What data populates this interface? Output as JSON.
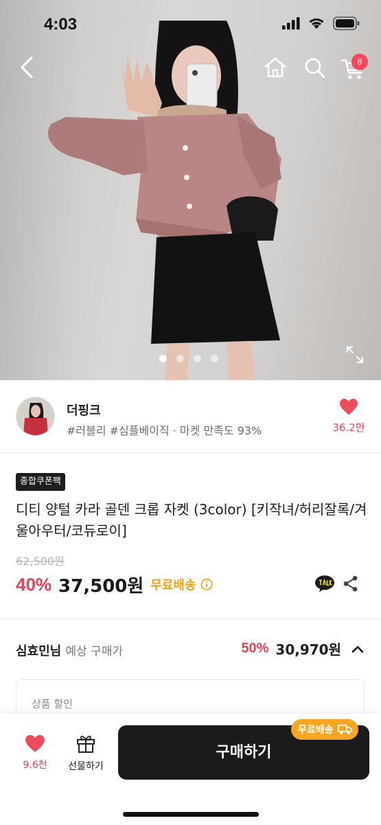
{
  "status_bar": {
    "time": "4:03"
  },
  "nav": {
    "cart_count": "8"
  },
  "gallery": {
    "page_count": 4,
    "active_index": 0
  },
  "seller": {
    "name": "더핑크",
    "meta": "#러블리 #심플베이직 · 마켓 만족도 93%",
    "like_count": "36.2만"
  },
  "product": {
    "badge": "종합쿠폰팩",
    "title": "디티 양털 카라 골덴 크롭 자켓 (3color) [키작녀/허리잘록/겨울아우터/코듀로이]",
    "original_price": "62,500원",
    "discount_rate": "40%",
    "final_price": "37,500원",
    "shipping_label": "무료배송"
  },
  "expected_price": {
    "user_name": "심효민님",
    "label": "예상 구매가",
    "discount_rate": "50%",
    "price": "30,970원"
  },
  "discount_card": {
    "label": "상품 할인"
  },
  "bottom_bar": {
    "like_count": "9.6천",
    "gift_label": "선물하기",
    "buy_label": "구매하기",
    "buy_badge": "무료배송"
  },
  "colors": {
    "accent_red": "#e8435a",
    "shipping_orange": "#f2a013",
    "buy_button": "#1b1b1b",
    "jacket_pink": "#b98685"
  },
  "icons": [
    "chevron-left-icon",
    "home-icon",
    "search-icon",
    "cart-icon",
    "expand-icon",
    "heart-icon",
    "info-icon",
    "kakao-talk-icon",
    "share-icon",
    "chevron-up-icon",
    "gift-icon",
    "truck-icon"
  ]
}
